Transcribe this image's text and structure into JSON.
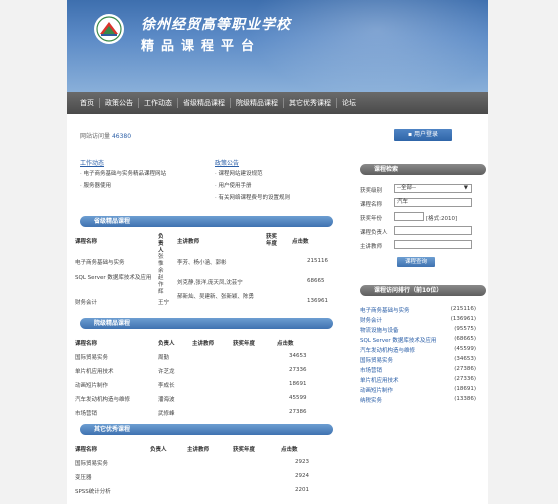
{
  "banner": {
    "school_name": "徐州经贸高等职业学校",
    "platform_name": "精品课程平台"
  },
  "nav": [
    "首页",
    "政策公告",
    "工作动态",
    "省级精品课程",
    "院级精品课程",
    "其它优秀课程",
    "论坛"
  ],
  "visits": {
    "label": "网站访问量",
    "count": "46380"
  },
  "login_button": "用户登录",
  "work_news": {
    "title": "工作动态",
    "items": [
      "电子商务基础与实务精品课程网站",
      "服务器使用"
    ]
  },
  "notices": {
    "title": "政策公告",
    "items": [
      "课程网站建设规范",
      "用户使用手册",
      "有关网络课程费号的设置规则"
    ]
  },
  "provincial": {
    "title": "省级精品课程",
    "headers": [
      "课程名称",
      "负责人",
      "主讲教师",
      "获奖年度",
      "点击数"
    ],
    "rows": [
      {
        "name": "电子商务基础与实务",
        "leader": "张惟余",
        "teachers": "李芳、杨小涵、郭彬",
        "year": "",
        "clicks": "215116"
      },
      {
        "name": "SQL Server 数据库技术及应用",
        "leader": "赵作辉",
        "teachers": "刘克静,张洋,庞天凤,沈芸宁",
        "year": "",
        "clicks": "68665"
      },
      {
        "name": "财务会计",
        "leader": "王宁",
        "teachers": "郝新灿、吴建新、张新颖、陈勇",
        "year": "",
        "clicks": "136961"
      }
    ]
  },
  "college": {
    "title": "院级精品课程",
    "headers": [
      "课程名称",
      "负责人",
      "主讲教师",
      "获奖年度",
      "点击数"
    ],
    "rows": [
      {
        "name": "国际贸易实务",
        "leader": "周勤",
        "teachers": "",
        "year": "",
        "clicks": "34653"
      },
      {
        "name": "单片机应用技术",
        "leader": "许芝龙",
        "teachers": "",
        "year": "",
        "clicks": "27336"
      },
      {
        "name": "动画短片制作",
        "leader": "李成长",
        "teachers": "",
        "year": "",
        "clicks": "18691"
      },
      {
        "name": "汽车发动机构造与维修",
        "leader": "潘海波",
        "teachers": "",
        "year": "",
        "clicks": "45599"
      },
      {
        "name": "市场营销",
        "leader": "武修峰",
        "teachers": "",
        "year": "",
        "clicks": "27386"
      }
    ]
  },
  "others": {
    "title": "其它优秀课程",
    "headers": [
      "课程名称",
      "负责人",
      "主讲教师",
      "获奖年度",
      "点击数"
    ],
    "rows": [
      {
        "name": "国际贸易实务",
        "clicks": "2923"
      },
      {
        "name": "变压器",
        "clicks": "2924"
      },
      {
        "name": "SPSS统计分析",
        "clicks": "2201"
      }
    ]
  },
  "search": {
    "title": "课程检索",
    "level_label": "获奖级别",
    "level_value": "--全部--",
    "name_label": "课程名称",
    "name_value": "汽车",
    "year_label": "获奖年份",
    "year_hint": "[格式:2010]",
    "leader_label": "课程负责人",
    "teacher_label": "主讲教师",
    "button": "课程查询"
  },
  "ranking": {
    "title": "课程访问排行（前10位）",
    "items": [
      {
        "name": "电子商务基础与实务",
        "count": "(215116)"
      },
      {
        "name": "财务会计",
        "count": "(136961)"
      },
      {
        "name": "物流设施与设备",
        "count": "(95575)"
      },
      {
        "name": "SQL Server 数据库技术及应用",
        "count": "(68665)"
      },
      {
        "name": "汽车发动机构造与维修",
        "count": "(45599)"
      },
      {
        "name": "国际贸易实务",
        "count": "(34653)"
      },
      {
        "name": "市场营销",
        "count": "(27386)"
      },
      {
        "name": "单片机应用技术",
        "count": "(27336)"
      },
      {
        "name": "动画短片制作",
        "count": "(18691)"
      },
      {
        "name": "纳税实务",
        "count": "(13386)"
      }
    ]
  },
  "colors": {
    "accent": "#3f72b0",
    "nav": "#4a4a4a",
    "link": "#2a5ea7"
  }
}
